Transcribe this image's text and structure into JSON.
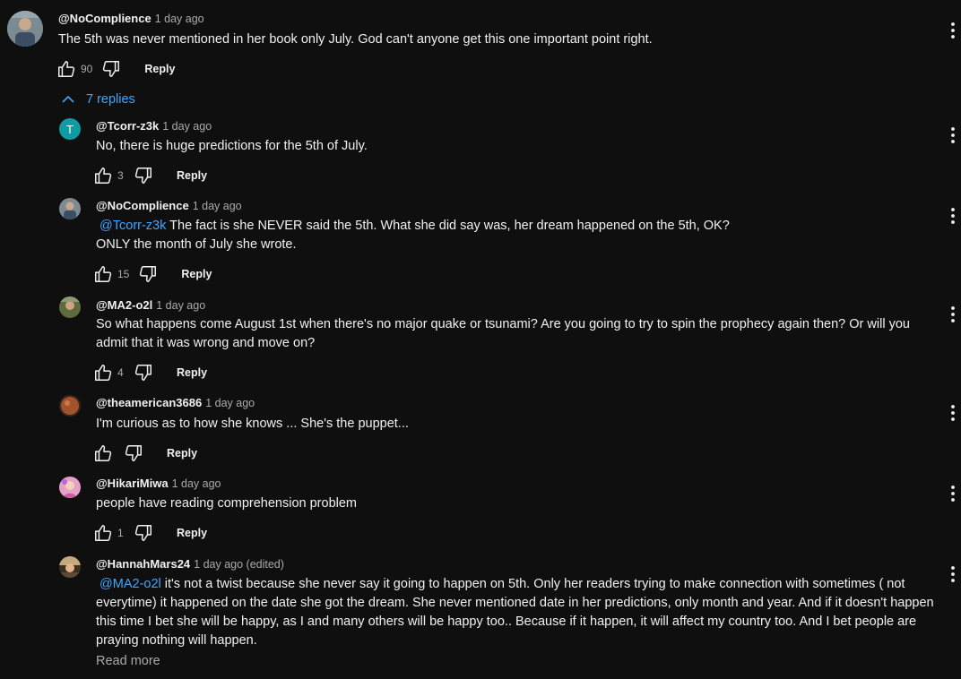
{
  "top_comment": {
    "author": "@NoComplience",
    "time": "1 day ago",
    "text": "The 5th was never mentioned in her book only July. God can't anyone get this one important point right.",
    "likes": "90",
    "reply_label": "Reply"
  },
  "replies_toggle": "7 replies",
  "replies": [
    {
      "author": "@Tcorr-z3k",
      "time": "1 day ago",
      "mention": "",
      "line1": "No, there is huge predictions for the 5th of July.",
      "line2": "",
      "likes": "3",
      "reply_label": "Reply",
      "avatar_letter": "T",
      "avatar_color": "#0e9ba4"
    },
    {
      "author": "@NoComplience",
      "time": "1 day ago",
      "mention": "@Tcorr-z3k",
      "line1": " The fact is she NEVER said the 5th. What she did say was, her dream happened on the 5th, OK?",
      "line2": "ONLY the month of July she wrote.",
      "likes": "15",
      "reply_label": "Reply"
    },
    {
      "author": "@MA2-o2l",
      "time": "1 day ago",
      "mention": "",
      "line1": "So what happens come August 1st when there's no major quake or tsunami? Are you going to try to spin the prophecy again then? Or will you",
      "line2": "admit that it was wrong and move on?",
      "likes": "4",
      "reply_label": "Reply"
    },
    {
      "author": "@theamerican3686",
      "time": "1 day ago",
      "mention": "",
      "line1": "I'm curious as to how she knows ... She's the puppet...",
      "line2": "",
      "likes": "",
      "reply_label": "Reply"
    },
    {
      "author": "@HikariMiwa",
      "time": "1 day ago",
      "mention": "",
      "line1": "people have reading comprehension problem",
      "line2": "",
      "likes": "1",
      "reply_label": "Reply"
    },
    {
      "author": "@HannahMars24",
      "time": "1 day ago (edited)",
      "mention": "@MA2-o2l",
      "line1": " it's not a twist because she never say it going to happen on 5th. Only her readers trying to make connection with sometimes ( not",
      "line2": "everytime) it happened on the date she got the dream. She never mentioned date in her predictions, only month and year. And if it doesn't happen",
      "line3": "this time I bet she will be happy, as I and many others will be happy too.. Because if it happen, it will affect my country too. And I bet people are",
      "line4": "praying nothing will happen.",
      "read_more": "Read more"
    }
  ],
  "colors": {
    "background": "#0f0f0f",
    "link": "#3ea6ff",
    "secondary_text": "#aaaaaa"
  }
}
